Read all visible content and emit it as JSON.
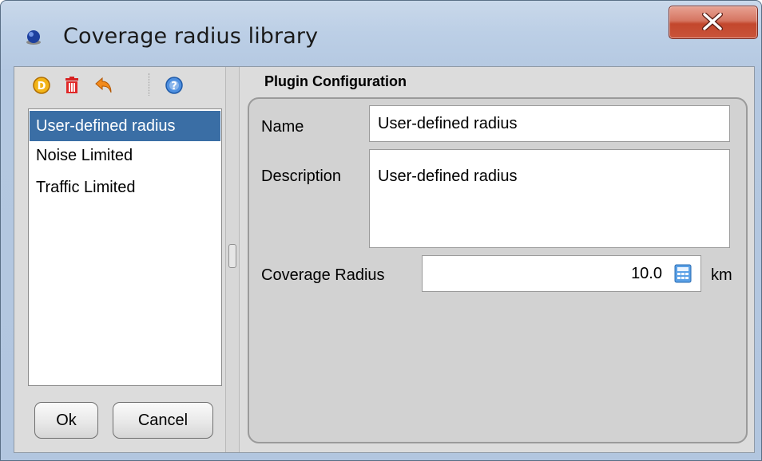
{
  "window": {
    "title": "Coverage radius library",
    "icons": {
      "app": "blue-globe-icon",
      "close": "close-x-icon"
    }
  },
  "toolbar": {
    "icons": [
      "default-plugin-icon",
      "delete-trash-icon",
      "undo-arrow-icon",
      "help-question-icon"
    ]
  },
  "plugin_list": {
    "items": [
      {
        "label": "User-defined radius",
        "selected": true
      },
      {
        "label": "Noise Limited",
        "selected": false
      },
      {
        "label": "Traffic Limited",
        "selected": false
      }
    ],
    "selection_color": "#3a6ea5"
  },
  "buttons": {
    "ok_label": "Ok",
    "cancel_label": "Cancel"
  },
  "config": {
    "section_title": "Plugin Configuration",
    "name_label": "Name",
    "name_value": "User-defined radius",
    "description_label": "Description",
    "description_value": "User-defined radius",
    "radius_label": "Coverage Radius",
    "radius_value": "10.0",
    "radius_unit": "km"
  }
}
